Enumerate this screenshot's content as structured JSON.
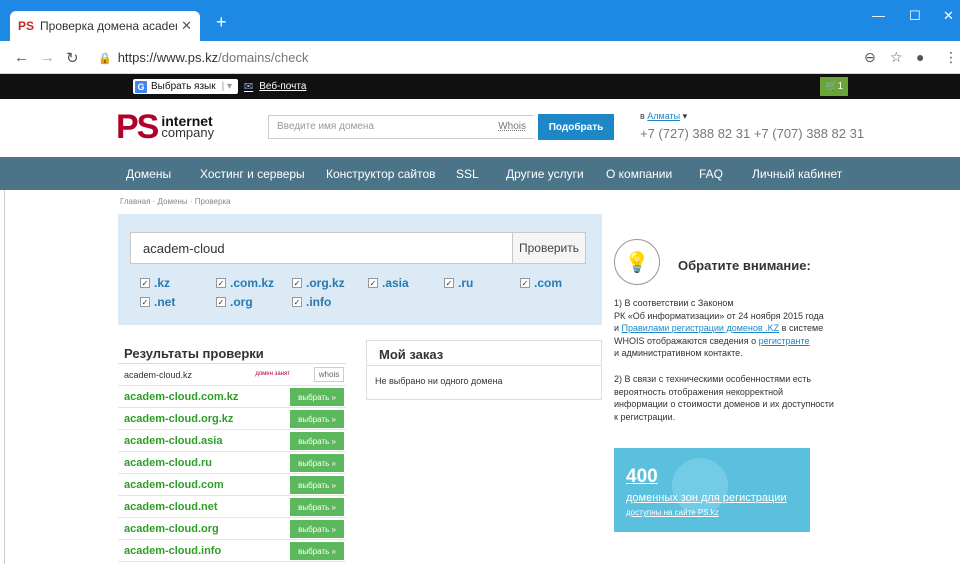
{
  "browser": {
    "tab_title": "Проверка домена academ-clou",
    "url_host": "https://www.ps.kz",
    "url_path": "/domains/check"
  },
  "topstrip": {
    "lang_label": "Выбрать язык",
    "webmail_label": "Веб-почта",
    "cart_count": "1"
  },
  "header": {
    "logo_mark": "PS",
    "logo_line1": "internet",
    "logo_line2": "company",
    "search_placeholder": "Введите имя домена",
    "whois_label": "Whois",
    "pick_button": "Подобрать",
    "city_prefix": "в",
    "city": "Алматы",
    "phones": "+7 (727) 388 82 31 +7 (707) 388 82 31"
  },
  "nav": [
    "Домены",
    "Хостинг и серверы",
    "Конструктор сайтов",
    "SSL",
    "Другие услуги",
    "О компании",
    "FAQ",
    "Личный кабинет"
  ],
  "breadcrumb": "Главная · Домены · Проверка",
  "check": {
    "input_value": "academ-cloud",
    "button_label": "Проверить",
    "zones": [
      ".kz",
      ".com.kz",
      ".org.kz",
      ".asia",
      ".ru",
      ".com",
      ".net",
      ".org",
      ".info"
    ]
  },
  "results": {
    "title": "Результаты проверки",
    "taken_domain": "academ-cloud.kz",
    "taken_label": "домен занят",
    "whois_label": "whois",
    "select_label": "выбрать »",
    "available": [
      "academ-cloud.com.kz",
      "academ-cloud.org.kz",
      "academ-cloud.asia",
      "academ-cloud.ru",
      "academ-cloud.com",
      "academ-cloud.net",
      "academ-cloud.org",
      "academ-cloud.info"
    ]
  },
  "order": {
    "title": "Мой заказ",
    "empty": "Не выбрано ни одного домена"
  },
  "notice": {
    "title": "Обратите внимание:",
    "p1_a": "1) В соответствии с Законом",
    "p1_b": "РК «Об информатизации» от 24 ноября 2015 года",
    "p1_c_pre": "и ",
    "p1_c_link": "Правилами регистрации доменов .KZ",
    "p1_c_post": " в системе",
    "p1_d_pre": "WHOIS отображаются сведения о ",
    "p1_d_link": "регистранте",
    "p1_e": "и административном контакте.",
    "p2_a": "2) В связи с техническими особенностями есть",
    "p2_b": "вероятность отображения некорректной",
    "p2_c": "информации о стоимости доменов и их доступности",
    "p2_d": "к регистрации."
  },
  "promo": {
    "number": "400",
    "line1": "доменных зон для регистрации",
    "line2": "доступны на сайте PS.kz"
  },
  "colors": {
    "titlebar": "#1e88e5",
    "nav_bg": "#4b7488",
    "brand_red": "#b2002d",
    "check_bg": "#dbeaf5",
    "select_green": "#5cb85c",
    "promo_blue": "#5bc0de"
  }
}
